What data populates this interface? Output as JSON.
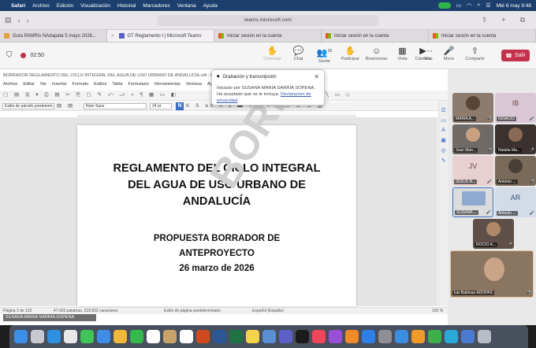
{
  "menubar": {
    "app": "Safari",
    "items": [
      "Archivo",
      "Edición",
      "Visualización",
      "Historial",
      "Marcadores",
      "Ventana",
      "Ayuda"
    ],
    "datetime": "Mié 6 may 9:48"
  },
  "safari": {
    "url": "teams.microsoft.com"
  },
  "tabs": [
    {
      "label": "Guía PAMRIs NAdapata 5 mayo 2026...",
      "color": "#e0a23a"
    },
    {
      "label": "GT Reglamento I | Microsoft Teams",
      "color": "#5b5fc7"
    },
    {
      "label": "Iniciar sesión en la cuenta",
      "color": "#f25022"
    },
    {
      "label": "Iniciar sesión en la cuenta",
      "color": "#f25022"
    },
    {
      "label": "Iniciar sesión en la cuenta",
      "color": "#f25022"
    }
  ],
  "teams": {
    "timer": "02:50",
    "toolbar": [
      {
        "label": "Controlar",
        "icon": "hand-icon",
        "disabled": true
      },
      {
        "label": "Chat",
        "icon": "chat-icon",
        "disabled": false
      },
      {
        "label": "Gente",
        "icon": "people-icon",
        "badge": "10",
        "disabled": false
      },
      {
        "label": "Participar",
        "icon": "raise-hand-icon",
        "disabled": false
      },
      {
        "label": "Reaccionar",
        "icon": "emoji-icon",
        "disabled": false
      },
      {
        "label": "Vista",
        "icon": "view-icon",
        "disabled": false
      },
      {
        "label": "Más",
        "icon": "more-icon",
        "disabled": false
      }
    ],
    "devices": [
      {
        "label": "Cámara",
        "icon": "camera-icon"
      },
      {
        "label": "Micro",
        "icon": "mic-icon"
      },
      {
        "label": "Compartir",
        "icon": "share-icon"
      }
    ],
    "leave_label": "Salir",
    "leave_color": "#c4314b"
  },
  "writer": {
    "title": "BORRADOR REGLAMENTO DEL CICLO INTEGRAL DEL AGUA DE USO URBANO DE ANDALUCÍA.odt - LibreOffice Writer",
    "menu": [
      "Archivo",
      "Editar",
      "Ver",
      "Insertar",
      "Formato",
      "Estilos",
      "Tabla",
      "Formulario",
      "Herramientas",
      "Ventana",
      "Ayuda"
    ],
    "paragraph_style": "Estilo de párrafo predeterm",
    "font_name": "Noto Sans",
    "font_size": "24 pt",
    "bold_label": "N",
    "doc": {
      "title_lines": [
        "REGLAMENTO DEL CICLO INTEGRAL",
        "DEL AGUA DE USO URBANO DE",
        "ANDALUCÍA"
      ],
      "sub_lines": [
        "PROPUESTA BORRADOR DE",
        "ANTEPROYECTO",
        "26 marzo de 2026"
      ],
      "watermark": "BORRADOR"
    },
    "status": {
      "page": "Página 1 de 120",
      "words": "47.603 palabras, 318.832 caracteres",
      "page_style": "Estilo de página predeterminado",
      "language": "Español (España)",
      "zoom": "100 %"
    }
  },
  "share_label": "SUSANA MARIA SARRIA SOPENA",
  "popup": {
    "title": "Grabación y transcripción",
    "body": "Iniciado por SUSANA MARIA SARRIA SOPENA. Ha aceptado que se le incluya.",
    "link": "Declaración de privacidad"
  },
  "participants": [
    {
      "name": "MARIA A...",
      "initials": "",
      "bg": "#8d7b6e"
    },
    {
      "name": "IGNACIO",
      "initials": "IB",
      "bg": "#d9c7d6"
    },
    {
      "name": "Juan Man...",
      "initials": "",
      "bg": "#6f6a66"
    },
    {
      "name": "Natalia Ma...",
      "initials": "",
      "bg": "#3b3230"
    },
    {
      "name": "JESUS R...",
      "initials": "JV",
      "bg": "#e8cfd0"
    },
    {
      "name": "Antonio ...",
      "initials": "",
      "bg": "#7a6a5a"
    },
    {
      "name": "SUSANA ...",
      "initials": "",
      "bg": "#dcdcdc"
    },
    {
      "name": "Antonio ...",
      "initials": "AR",
      "bg": "#d3dbe8"
    },
    {
      "name": "ROCIO A...",
      "initials": "",
      "bg": "#5e5048"
    },
    {
      "name": "luis Babinao ADOPAS",
      "initials": "",
      "bg": "#8a7560"
    }
  ],
  "dock": [
    {
      "icon": "finder-icon",
      "color": "#3d8ee8"
    },
    {
      "icon": "launchpad-icon",
      "color": "#c8c8d0"
    },
    {
      "icon": "safari-icon",
      "color": "#2f8fe0"
    },
    {
      "icon": "chrome-icon",
      "color": "#e8e8e8"
    },
    {
      "icon": "messages-icon",
      "color": "#3ec458"
    },
    {
      "icon": "mail-icon",
      "color": "#3f8de6"
    },
    {
      "icon": "photos-icon",
      "color": "#f0b93a"
    },
    {
      "icon": "facetime-icon",
      "color": "#35b84e"
    },
    {
      "icon": "calendar-icon",
      "color": "#ffffff"
    },
    {
      "icon": "contacts-icon",
      "color": "#c9a26b"
    },
    {
      "icon": "reminders-icon",
      "color": "#ffffff"
    },
    {
      "icon": "powerpoint-icon",
      "color": "#d04a1f"
    },
    {
      "icon": "word-icon",
      "color": "#2b5797"
    },
    {
      "icon": "excel-icon",
      "color": "#1f7244"
    },
    {
      "icon": "notes-icon",
      "color": "#f4d34a"
    },
    {
      "icon": "files-icon",
      "color": "#5a8fd6"
    },
    {
      "icon": "teams-icon",
      "color": "#5b5fc7"
    },
    {
      "icon": "appletv-icon",
      "color": "#1b1b1b"
    },
    {
      "icon": "music-icon",
      "color": "#f0455a"
    },
    {
      "icon": "podcasts-icon",
      "color": "#9a4fd8"
    },
    {
      "icon": "books-icon",
      "color": "#f08a28"
    },
    {
      "icon": "appstore-icon",
      "color": "#2f7fe8"
    },
    {
      "icon": "settings-icon",
      "color": "#8e8e93"
    },
    {
      "icon": "keynote-icon",
      "color": "#3a8ee0"
    },
    {
      "icon": "pages-icon",
      "color": "#f09a2a"
    },
    {
      "icon": "numbers-icon",
      "color": "#3cb04a"
    },
    {
      "icon": "libreoffice-icon",
      "color": "#2aa8d8"
    },
    {
      "icon": "downloads-icon",
      "color": "#4a7bd0"
    },
    {
      "icon": "trash-icon",
      "color": "#b8bcc4"
    }
  ]
}
